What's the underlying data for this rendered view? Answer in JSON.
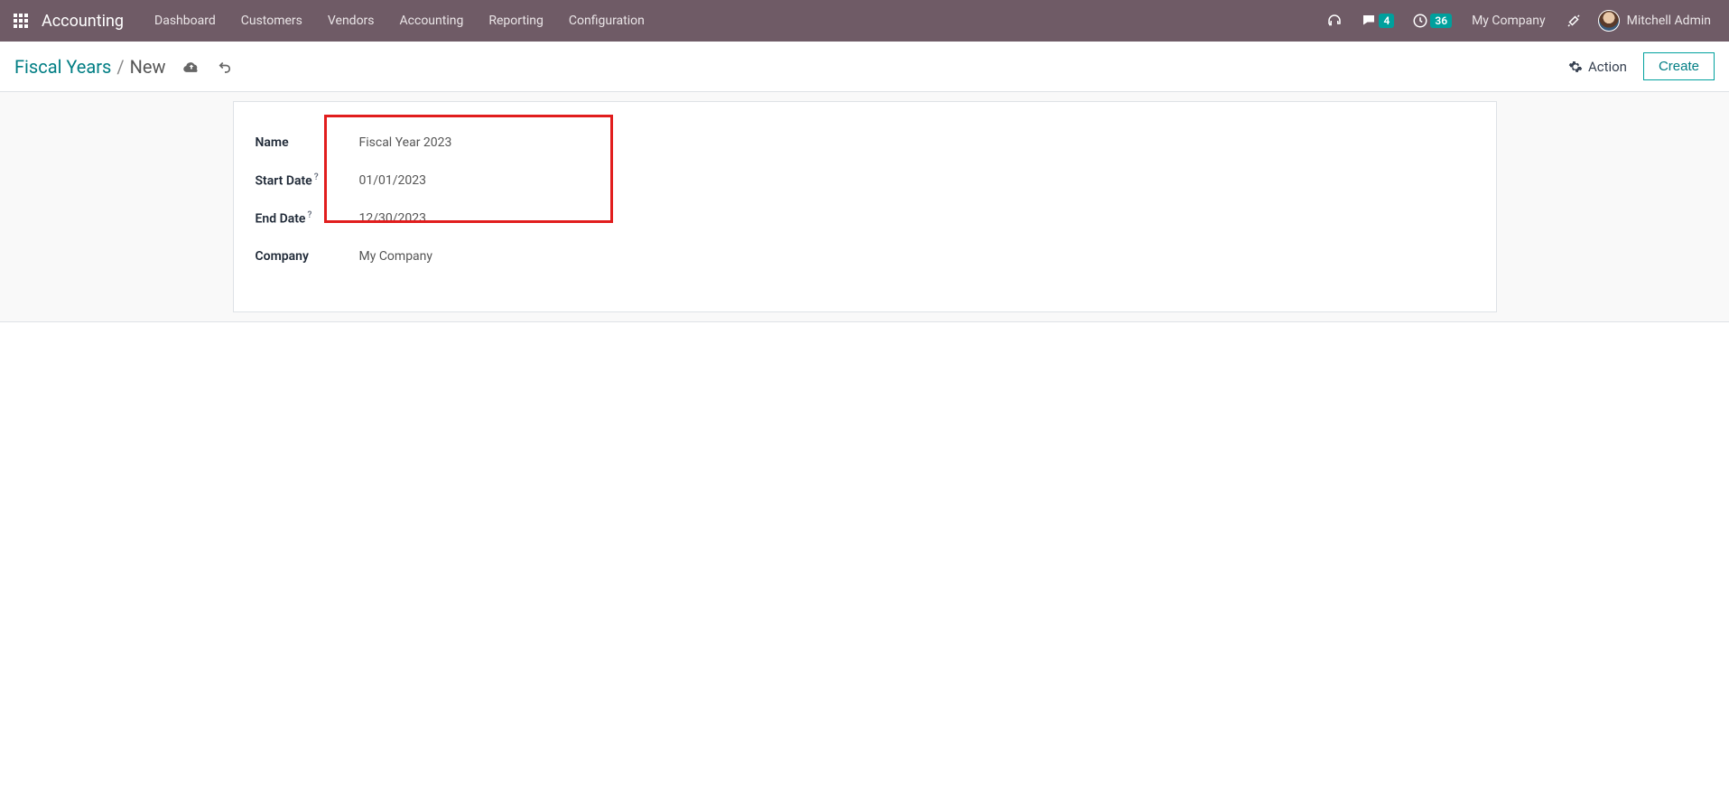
{
  "nav": {
    "app_title": "Accounting",
    "menu": [
      "Dashboard",
      "Customers",
      "Vendors",
      "Accounting",
      "Reporting",
      "Configuration"
    ],
    "messages_badge": "4",
    "activities_badge": "36",
    "company": "My Company",
    "user_name": "Mitchell Admin"
  },
  "breadcrumb": {
    "parent": "Fiscal Years",
    "current": "New"
  },
  "actions": {
    "action_label": "Action",
    "create_label": "Create"
  },
  "form": {
    "name_label": "Name",
    "name_value": "Fiscal Year 2023",
    "start_date_label": "Start Date",
    "start_date_value": "01/01/2023",
    "end_date_label": "End Date",
    "end_date_value": "12/30/2023",
    "company_label": "Company",
    "company_value": "My Company",
    "help_marker": "?"
  }
}
